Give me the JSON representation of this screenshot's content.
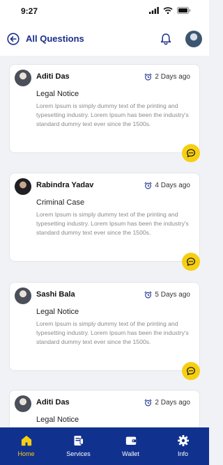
{
  "status": {
    "time": "9:27"
  },
  "header": {
    "title": "All Questions"
  },
  "questions": [
    {
      "name": "Aditi Das",
      "time": "2 Days ago",
      "subject": "Legal Notice",
      "description": "Lorem Ipsum is simply dummy text of the printing and typesetting industry. Lorem Ipsum has been the industry's standard dummy text ever since the 1500s."
    },
    {
      "name": "Rabindra Yadav",
      "time": "4 Days ago",
      "subject": "Criminal Case",
      "description": "Lorem Ipsum is simply dummy text of the printing and typesetting industry. Lorem Ipsum has been the industry's standard dummy text ever since the 1500s."
    },
    {
      "name": "Sashi Bala",
      "time": "5 Days ago",
      "subject": "Legal Notice",
      "description": "Lorem Ipsum is simply dummy text of the printing and typesetting industry. Lorem Ipsum has been the industry's standard dummy text ever since the 1500s."
    },
    {
      "name": "Aditi Das",
      "time": "2 Days ago",
      "subject": "Legal Notice",
      "description": ""
    }
  ],
  "nav": {
    "home": "Home",
    "services": "Services",
    "wallet": "Wallet",
    "info": "Info"
  },
  "colors": {
    "primary": "#11318f",
    "accent": "#f6cf12",
    "title": "#1a2e8a"
  }
}
